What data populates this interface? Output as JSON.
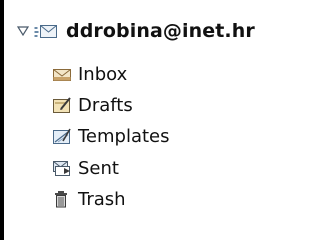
{
  "account": {
    "label": "ddrobina@inet.hr",
    "icon": "mail-account-icon",
    "expanded": true
  },
  "folders": [
    {
      "label": "Inbox",
      "icon": "inbox-icon"
    },
    {
      "label": "Drafts",
      "icon": "drafts-icon"
    },
    {
      "label": "Templates",
      "icon": "templates-icon"
    },
    {
      "label": "Sent",
      "icon": "sent-icon"
    },
    {
      "label": "Trash",
      "icon": "trash-icon"
    }
  ],
  "colors": {
    "border": "#000000",
    "text": "#111111",
    "accent": "#4a82c3"
  }
}
